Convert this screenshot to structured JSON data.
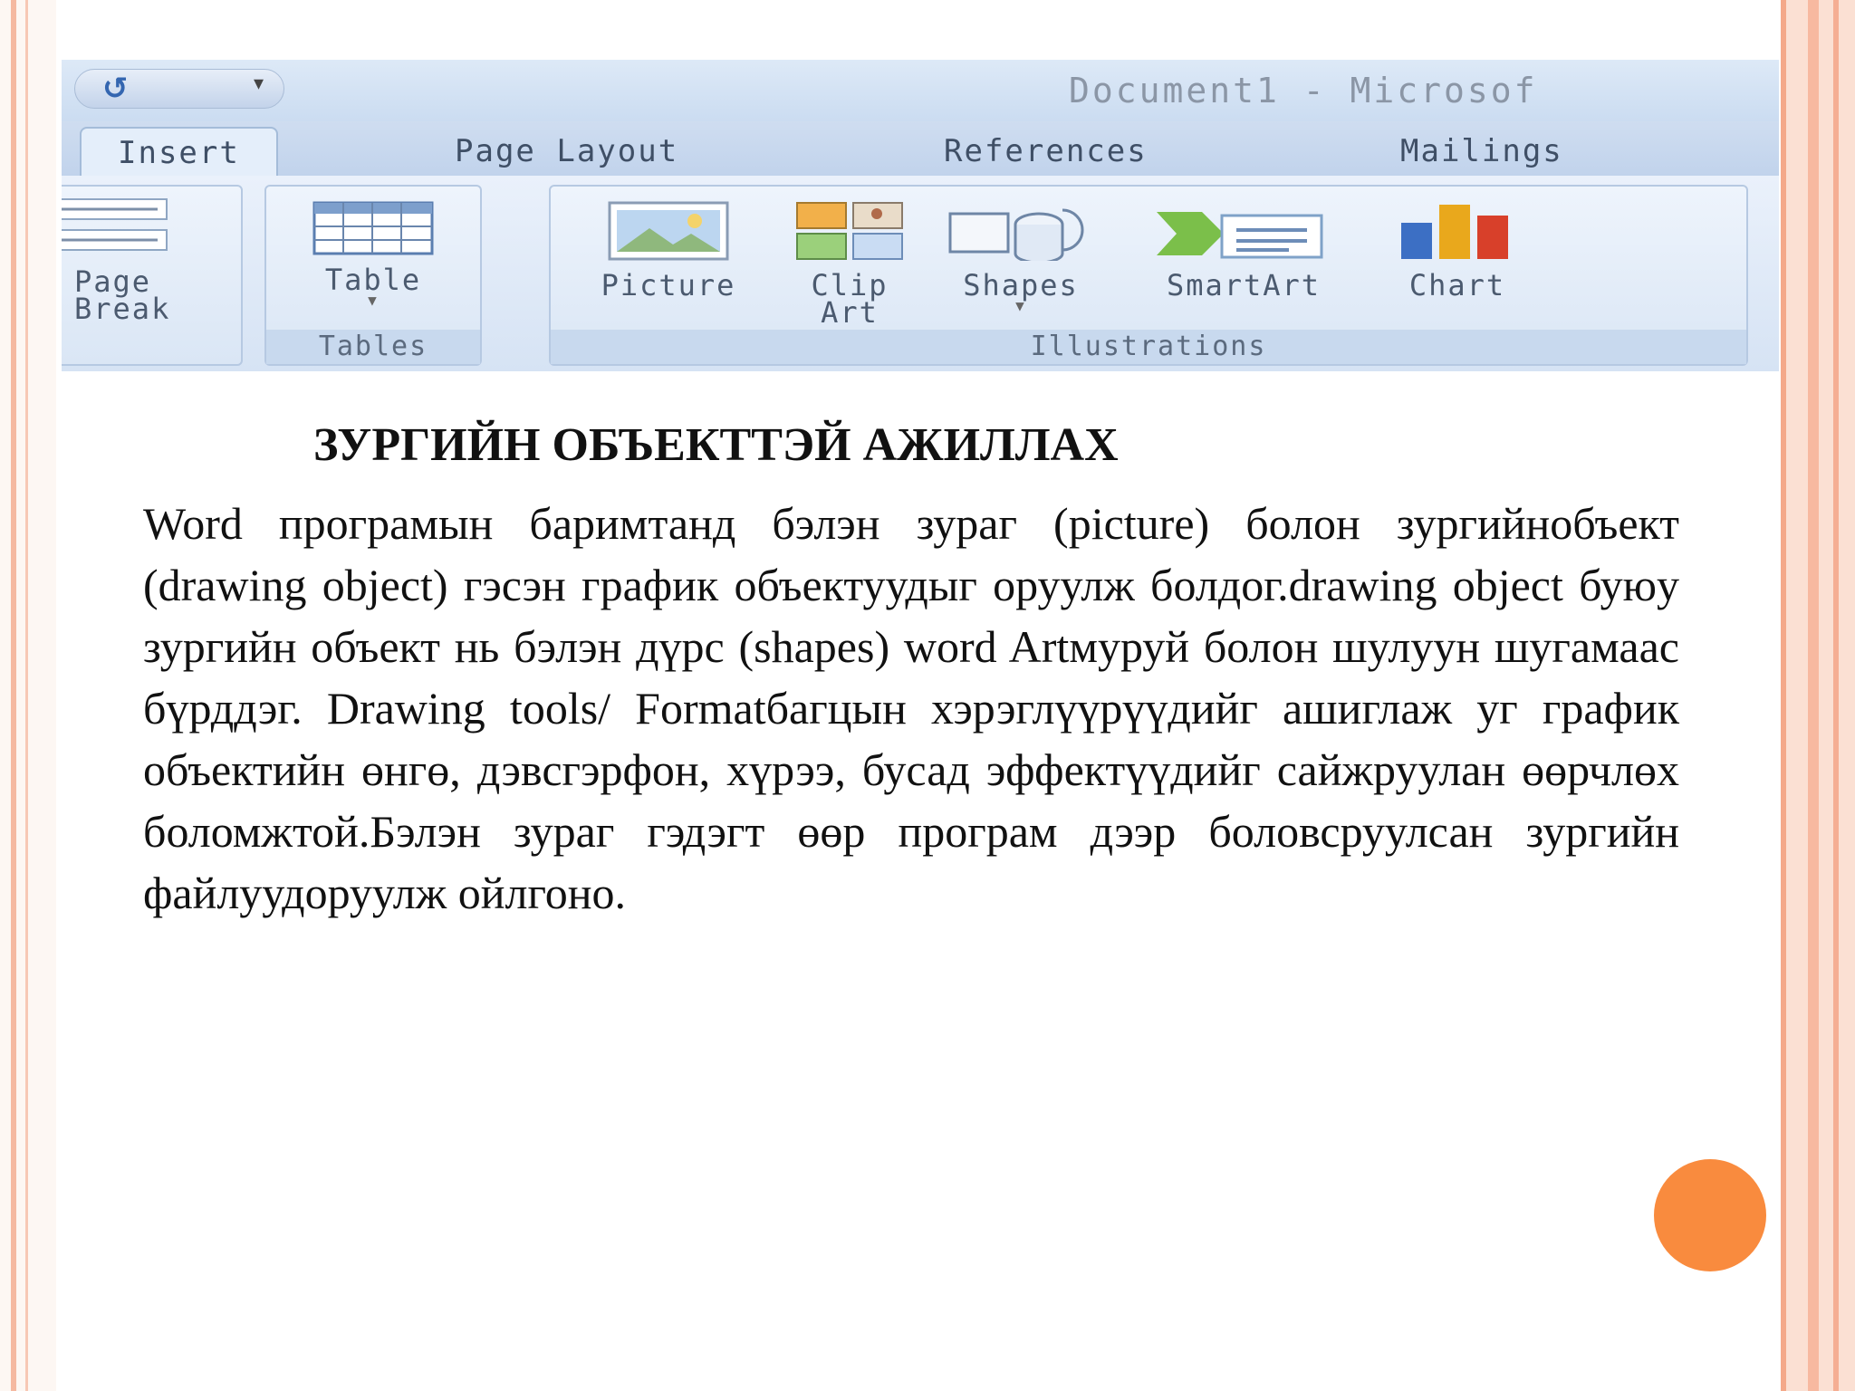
{
  "window": {
    "title": "Document1 - Microsof"
  },
  "tabs": [
    "Insert",
    "Page Layout",
    "References",
    "Mailings"
  ],
  "groups": {
    "pages": {
      "command": "Page Break",
      "command_line1": "Page",
      "command_line2": "Break"
    },
    "tables": {
      "label": "Tables",
      "command": "Table"
    },
    "illustrations": {
      "label": "Illustrations",
      "picture": "Picture",
      "clip_art_line1": "Clip",
      "clip_art_line2": "Art",
      "shapes": "Shapes",
      "smartart": "SmartArt",
      "chart": "Chart"
    }
  },
  "slide": {
    "title": "ЗУРГИЙН ОБЪЕКТТЭЙ АЖИЛЛАХ",
    "body": "Word програмын баримтанд бэлэн зураг (picture) болон зургийнобъект (drawing object) гэсэн график объектуудыг оруулж болдог.drawing object буюу зургийн объект нь бэлэн дүрс (shapes) word Artмуруй болон шулуун шугамаас бүрддэг. Drawing tools/ Formatбагцын хэрэглүүрүүдийг ашиглаж уг график объектийн өнгө, дэвсгэрфон, хүрээ, бусад эффектүүдийг сайжруулан өөрчлөх боломжтой.Бэлэн зураг гэдэгт өөр програм дээр боловсруулсан зургийн файлуудоруулж ойлгоно."
  },
  "colors": {
    "accent_orange": "#f98b3e",
    "ribbon_blue": "#d9e6f6"
  }
}
